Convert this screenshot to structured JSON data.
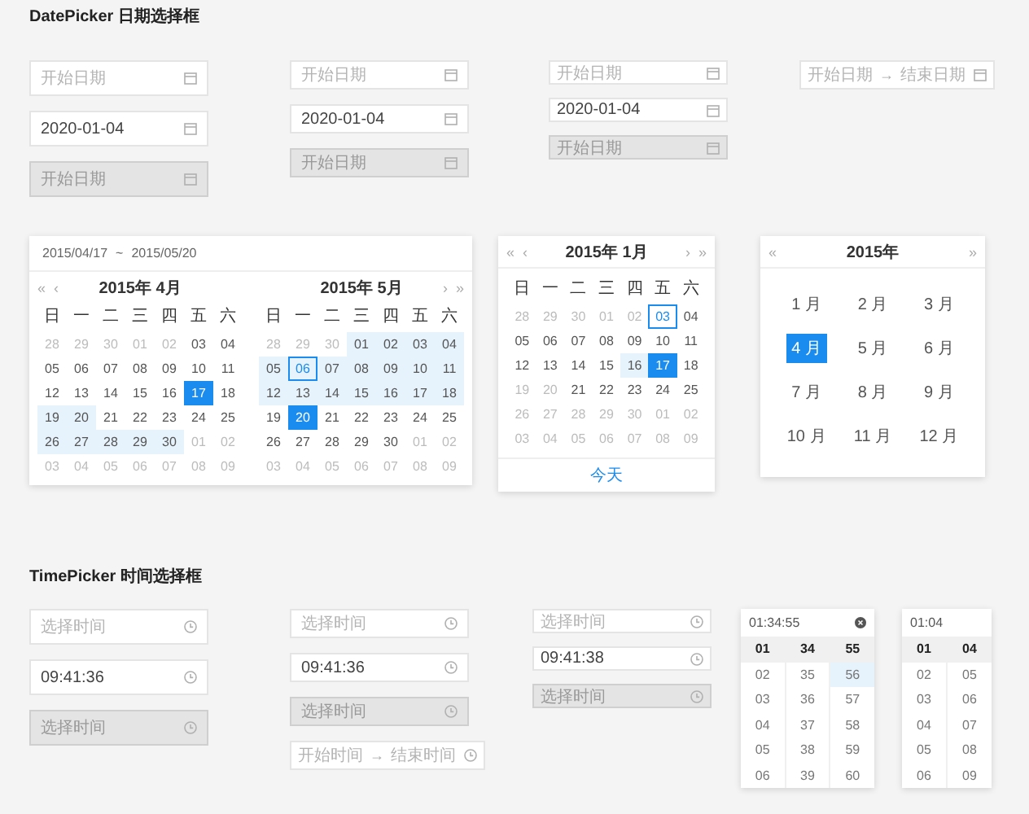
{
  "date_picker": {
    "title": "DatePicker 日期选择框",
    "field_columns": [
      {
        "fields": [
          {
            "kind": "single",
            "placeholder": "开始日期",
            "disabled": false
          },
          {
            "kind": "single",
            "value": "2020-01-04",
            "disabled": false
          },
          {
            "kind": "single",
            "placeholder": "开始日期",
            "disabled": true
          }
        ]
      },
      {
        "fields": [
          {
            "kind": "single",
            "placeholder": "开始日期",
            "disabled": false
          },
          {
            "kind": "single",
            "value": "2020-01-04",
            "disabled": false
          },
          {
            "kind": "single",
            "placeholder": "开始日期",
            "disabled": true
          }
        ]
      },
      {
        "fields": [
          {
            "kind": "single",
            "placeholder": "开始日期",
            "disabled": false
          },
          {
            "kind": "single",
            "value": "2020-01-04",
            "disabled": false
          },
          {
            "kind": "single",
            "placeholder": "开始日期",
            "disabled": true
          }
        ]
      },
      {
        "fields": [
          {
            "kind": "range",
            "placeholder": "开始日期",
            "separator": "→",
            "end_placeholder": "结束日期",
            "disabled": false
          }
        ]
      }
    ],
    "range_calendar": {
      "start": "2015/04/17",
      "separator": "~",
      "end": "2015/05/20",
      "months": [
        {
          "nav_left": [
            "«",
            "‹"
          ],
          "title": "2015年 4月",
          "weekdays": [
            "日",
            "一",
            "二",
            "三",
            "四",
            "五",
            "六"
          ],
          "weeks": [
            [
              {
                "d": "28",
                "kind": "other"
              },
              {
                "d": "29",
                "kind": "other"
              },
              {
                "d": "30",
                "kind": "other"
              },
              {
                "d": "01",
                "kind": "other"
              },
              {
                "d": "02",
                "kind": "other"
              },
              {
                "d": "03",
                "kind": "normal"
              },
              {
                "d": "04",
                "kind": "normal"
              }
            ],
            [
              {
                "d": "05",
                "kind": "normal"
              },
              {
                "d": "06",
                "kind": "normal"
              },
              {
                "d": "07",
                "kind": "normal"
              },
              {
                "d": "08",
                "kind": "normal"
              },
              {
                "d": "09",
                "kind": "normal"
              },
              {
                "d": "10",
                "kind": "normal"
              },
              {
                "d": "11",
                "kind": "normal"
              }
            ],
            [
              {
                "d": "12",
                "kind": "normal"
              },
              {
                "d": "13",
                "kind": "normal"
              },
              {
                "d": "14",
                "kind": "normal"
              },
              {
                "d": "15",
                "kind": "normal"
              },
              {
                "d": "16",
                "kind": "normal"
              },
              {
                "d": "17",
                "kind": "selected"
              },
              {
                "d": "18",
                "kind": "normal"
              }
            ],
            [
              {
                "d": "19",
                "kind": "range"
              },
              {
                "d": "20",
                "kind": "range"
              },
              {
                "d": "21",
                "kind": "normal"
              },
              {
                "d": "22",
                "kind": "normal"
              },
              {
                "d": "23",
                "kind": "normal"
              },
              {
                "d": "24",
                "kind": "normal"
              },
              {
                "d": "25",
                "kind": "normal"
              }
            ],
            [
              {
                "d": "26",
                "kind": "range"
              },
              {
                "d": "27",
                "kind": "range"
              },
              {
                "d": "28",
                "kind": "range"
              },
              {
                "d": "29",
                "kind": "range"
              },
              {
                "d": "30",
                "kind": "range"
              },
              {
                "d": "01",
                "kind": "other"
              },
              {
                "d": "02",
                "kind": "other"
              }
            ],
            [
              {
                "d": "03",
                "kind": "other"
              },
              {
                "d": "04",
                "kind": "other"
              },
              {
                "d": "05",
                "kind": "other"
              },
              {
                "d": "06",
                "kind": "other"
              },
              {
                "d": "07",
                "kind": "other"
              },
              {
                "d": "08",
                "kind": "other"
              },
              {
                "d": "09",
                "kind": "other"
              }
            ]
          ]
        },
        {
          "nav_right": [
            "›",
            "»"
          ],
          "title": "2015年 5月",
          "weekdays": [
            "日",
            "一",
            "二",
            "三",
            "四",
            "五",
            "六"
          ],
          "weeks": [
            [
              {
                "d": "28",
                "kind": "other"
              },
              {
                "d": "29",
                "kind": "other"
              },
              {
                "d": "30",
                "kind": "other"
              },
              {
                "d": "01",
                "kind": "range"
              },
              {
                "d": "02",
                "kind": "range"
              },
              {
                "d": "03",
                "kind": "range"
              },
              {
                "d": "04",
                "kind": "range"
              }
            ],
            [
              {
                "d": "05",
                "kind": "range"
              },
              {
                "d": "06",
                "kind": "today_range"
              },
              {
                "d": "07",
                "kind": "range"
              },
              {
                "d": "08",
                "kind": "range"
              },
              {
                "d": "09",
                "kind": "range"
              },
              {
                "d": "10",
                "kind": "range"
              },
              {
                "d": "11",
                "kind": "range"
              }
            ],
            [
              {
                "d": "12",
                "kind": "range"
              },
              {
                "d": "13",
                "kind": "range"
              },
              {
                "d": "14",
                "kind": "range"
              },
              {
                "d": "15",
                "kind": "range"
              },
              {
                "d": "16",
                "kind": "range"
              },
              {
                "d": "17",
                "kind": "range"
              },
              {
                "d": "18",
                "kind": "range"
              }
            ],
            [
              {
                "d": "19",
                "kind": "normal"
              },
              {
                "d": "20",
                "kind": "selected"
              },
              {
                "d": "21",
                "kind": "normal"
              },
              {
                "d": "22",
                "kind": "normal"
              },
              {
                "d": "23",
                "kind": "normal"
              },
              {
                "d": "24",
                "kind": "normal"
              },
              {
                "d": "25",
                "kind": "normal"
              }
            ],
            [
              {
                "d": "26",
                "kind": "normal"
              },
              {
                "d": "27",
                "kind": "normal"
              },
              {
                "d": "28",
                "kind": "normal"
              },
              {
                "d": "29",
                "kind": "normal"
              },
              {
                "d": "30",
                "kind": "normal"
              },
              {
                "d": "01",
                "kind": "other"
              },
              {
                "d": "02",
                "kind": "other"
              }
            ],
            [
              {
                "d": "03",
                "kind": "other"
              },
              {
                "d": "04",
                "kind": "other"
              },
              {
                "d": "05",
                "kind": "other"
              },
              {
                "d": "06",
                "kind": "other"
              },
              {
                "d": "07",
                "kind": "other"
              },
              {
                "d": "08",
                "kind": "other"
              },
              {
                "d": "09",
                "kind": "other"
              }
            ]
          ]
        }
      ]
    },
    "date_calendar": {
      "nav_left": [
        "«",
        "‹"
      ],
      "title": "2015年 1月",
      "nav_right": [
        "›",
        "»"
      ],
      "weekdays": [
        "日",
        "一",
        "二",
        "三",
        "四",
        "五",
        "六"
      ],
      "weeks": [
        [
          {
            "d": "28",
            "kind": "other"
          },
          {
            "d": "29",
            "kind": "other"
          },
          {
            "d": "30",
            "kind": "other"
          },
          {
            "d": "01",
            "kind": "other"
          },
          {
            "d": "02",
            "kind": "other"
          },
          {
            "d": "03",
            "kind": "today"
          },
          {
            "d": "04",
            "kind": "normal"
          }
        ],
        [
          {
            "d": "05",
            "kind": "normal"
          },
          {
            "d": "06",
            "kind": "normal"
          },
          {
            "d": "07",
            "kind": "normal"
          },
          {
            "d": "08",
            "kind": "normal"
          },
          {
            "d": "09",
            "kind": "normal"
          },
          {
            "d": "10",
            "kind": "normal"
          },
          {
            "d": "11",
            "kind": "normal"
          }
        ],
        [
          {
            "d": "12",
            "kind": "normal"
          },
          {
            "d": "13",
            "kind": "normal"
          },
          {
            "d": "14",
            "kind": "normal"
          },
          {
            "d": "15",
            "kind": "normal"
          },
          {
            "d": "16",
            "kind": "range"
          },
          {
            "d": "17",
            "kind": "selected"
          },
          {
            "d": "18",
            "kind": "normal"
          }
        ],
        [
          {
            "d": "19",
            "kind": "other"
          },
          {
            "d": "20",
            "kind": "other"
          },
          {
            "d": "21",
            "kind": "normal"
          },
          {
            "d": "22",
            "kind": "normal"
          },
          {
            "d": "23",
            "kind": "normal"
          },
          {
            "d": "24",
            "kind": "normal"
          },
          {
            "d": "25",
            "kind": "normal"
          }
        ],
        [
          {
            "d": "26",
            "kind": "other"
          },
          {
            "d": "27",
            "kind": "other"
          },
          {
            "d": "28",
            "kind": "other"
          },
          {
            "d": "29",
            "kind": "other"
          },
          {
            "d": "30",
            "kind": "other"
          },
          {
            "d": "01",
            "kind": "other"
          },
          {
            "d": "02",
            "kind": "other"
          }
        ],
        [
          {
            "d": "03",
            "kind": "other"
          },
          {
            "d": "04",
            "kind": "other"
          },
          {
            "d": "05",
            "kind": "other"
          },
          {
            "d": "06",
            "kind": "other"
          },
          {
            "d": "07",
            "kind": "other"
          },
          {
            "d": "08",
            "kind": "other"
          },
          {
            "d": "09",
            "kind": "other"
          }
        ]
      ],
      "footer_link": "今天"
    },
    "month_calendar": {
      "nav_left": [
        "«"
      ],
      "title": "2015年",
      "nav_right": [
        "»"
      ],
      "months": [
        {
          "label": "1 月",
          "selected": false
        },
        {
          "label": "2 月",
          "selected": false
        },
        {
          "label": "3 月",
          "selected": false
        },
        {
          "label": "4 月",
          "selected": true
        },
        {
          "label": "5 月",
          "selected": false
        },
        {
          "label": "6 月",
          "selected": false
        },
        {
          "label": "7 月",
          "selected": false
        },
        {
          "label": "8 月",
          "selected": false
        },
        {
          "label": "9 月",
          "selected": false
        },
        {
          "label": "10 月",
          "selected": false
        },
        {
          "label": "11 月",
          "selected": false
        },
        {
          "label": "12 月",
          "selected": false
        }
      ]
    }
  },
  "time_picker": {
    "title": "TimePicker 时间选择框",
    "field_columns": [
      {
        "fields": [
          {
            "kind": "single",
            "placeholder": "选择时间",
            "disabled": false
          },
          {
            "kind": "single",
            "value": "09:41:36",
            "disabled": false
          },
          {
            "kind": "single",
            "placeholder": "选择时间",
            "disabled": true
          }
        ]
      },
      {
        "fields": [
          {
            "kind": "single",
            "placeholder": "选择时间",
            "disabled": false
          },
          {
            "kind": "single",
            "value": "09:41:36",
            "disabled": false
          },
          {
            "kind": "single",
            "placeholder": "选择时间",
            "disabled": true
          },
          {
            "kind": "range",
            "placeholder": "开始时间",
            "separator": "→",
            "end_placeholder": "结束时间",
            "disabled": false
          }
        ]
      },
      {
        "fields": [
          {
            "kind": "single",
            "placeholder": "选择时间",
            "disabled": false
          },
          {
            "kind": "single",
            "value": "09:41:38",
            "disabled": false
          },
          {
            "kind": "single",
            "placeholder": "选择时间",
            "disabled": true
          }
        ]
      }
    ],
    "panels": [
      {
        "header": "01:34:55",
        "clearable": true,
        "columns": [
          {
            "cells": [
              {
                "text": "01",
                "selected": true,
                "hovered": false
              },
              {
                "text": "02",
                "selected": false,
                "hovered": false
              },
              {
                "text": "03",
                "selected": false,
                "hovered": false
              },
              {
                "text": "04",
                "selected": false,
                "hovered": false
              },
              {
                "text": "05",
                "selected": false,
                "hovered": false
              },
              {
                "text": "06",
                "selected": false,
                "hovered": false
              }
            ]
          },
          {
            "cells": [
              {
                "text": "34",
                "selected": true,
                "hovered": false
              },
              {
                "text": "35",
                "selected": false,
                "hovered": false
              },
              {
                "text": "36",
                "selected": false,
                "hovered": false
              },
              {
                "text": "37",
                "selected": false,
                "hovered": false
              },
              {
                "text": "38",
                "selected": false,
                "hovered": false
              },
              {
                "text": "39",
                "selected": false,
                "hovered": false
              }
            ]
          },
          {
            "cells": [
              {
                "text": "55",
                "selected": true,
                "hovered": false
              },
              {
                "text": "56",
                "selected": false,
                "hovered": true
              },
              {
                "text": "57",
                "selected": false,
                "hovered": false
              },
              {
                "text": "58",
                "selected": false,
                "hovered": false
              },
              {
                "text": "59",
                "selected": false,
                "hovered": false
              },
              {
                "text": "60",
                "selected": false,
                "hovered": false
              }
            ]
          }
        ]
      },
      {
        "header": "01:04",
        "clearable": false,
        "columns": [
          {
            "cells": [
              {
                "text": "01",
                "selected": true,
                "hovered": false
              },
              {
                "text": "02",
                "selected": false,
                "hovered": false
              },
              {
                "text": "03",
                "selected": false,
                "hovered": false
              },
              {
                "text": "04",
                "selected": false,
                "hovered": false
              },
              {
                "text": "05",
                "selected": false,
                "hovered": false
              },
              {
                "text": "06",
                "selected": false,
                "hovered": false
              }
            ]
          },
          {
            "cells": [
              {
                "text": "04",
                "selected": true,
                "hovered": false
              },
              {
                "text": "05",
                "selected": false,
                "hovered": false
              },
              {
                "text": "06",
                "selected": false,
                "hovered": false
              },
              {
                "text": "07",
                "selected": false,
                "hovered": false
              },
              {
                "text": "08",
                "selected": false,
                "hovered": false
              },
              {
                "text": "09",
                "selected": false,
                "hovered": false
              }
            ]
          }
        ]
      }
    ]
  }
}
